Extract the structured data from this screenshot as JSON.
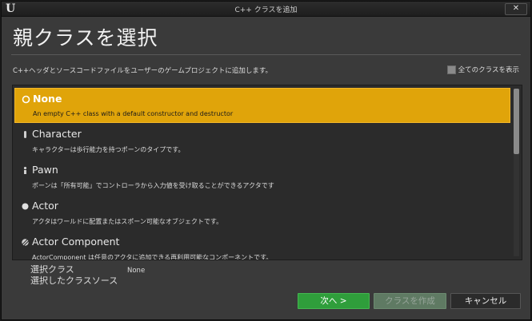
{
  "window": {
    "title": "C++ クラスを追加",
    "close_label": "✕"
  },
  "heading": "親クラスを選択",
  "description": "C++ヘッダとソースコードファイルをユーザーのゲームプロジェクトに追加します。",
  "show_all": {
    "label": "全てのクラスを表示",
    "checked": false
  },
  "classes": [
    {
      "name": "None",
      "desc": "An empty C++ class with a default constructor and destructor",
      "icon": "none-circle-icon",
      "selected": true
    },
    {
      "name": "Character",
      "desc": "キャラクターは歩行能力を持つポーンのタイプです。",
      "icon": "character-icon",
      "selected": false
    },
    {
      "name": "Pawn",
      "desc": "ポーンは「所有可能」でコントローラから入力値を受け取ることができるアクタです",
      "icon": "pawn-icon",
      "selected": false
    },
    {
      "name": "Actor",
      "desc": "アクタはワールドに配置またはスポーン可能なオブジェクトです。",
      "icon": "actor-icon",
      "selected": false
    },
    {
      "name": "Actor Component",
      "desc": "ActorComponent は任意のアクタに追加できる再利用可能なコンポーネントです。",
      "icon": "actor-component-icon",
      "selected": false
    }
  ],
  "info": {
    "selected_class_label": "選択クラス",
    "selected_source_label": "選択したクラスソース",
    "selected_class_value": "None"
  },
  "buttons": {
    "next": "次へ >",
    "create": "クラスを作成",
    "cancel": "キャンセル"
  },
  "colors": {
    "selection": "#e0a40a",
    "primary_button": "#2f9e3b",
    "disabled_button": "#5f7a63"
  }
}
